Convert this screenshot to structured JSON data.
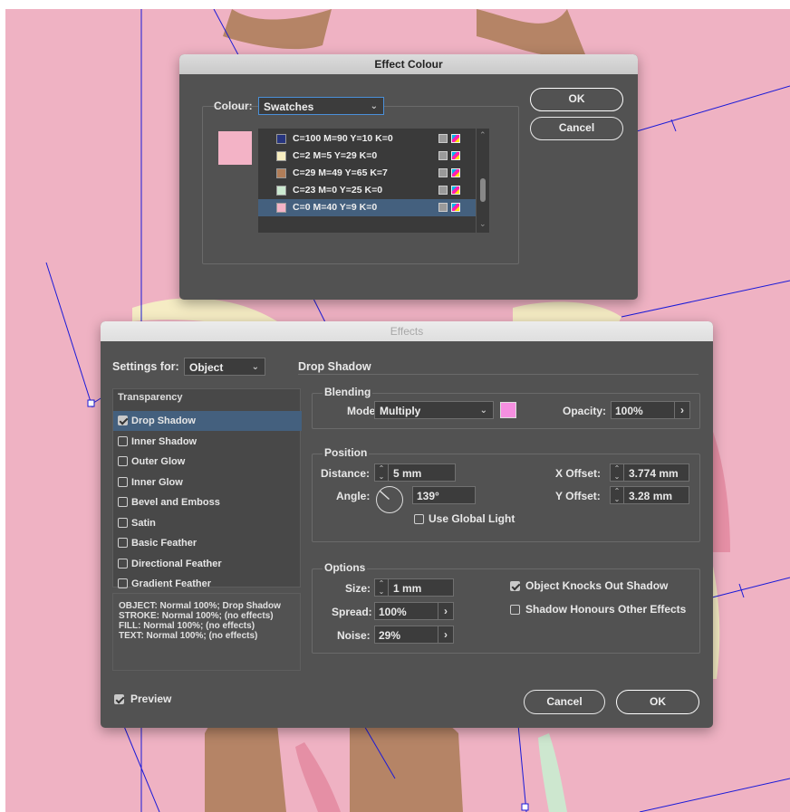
{
  "effect_colour_dialog": {
    "title": "Effect Colour",
    "colour_label": "Colour:",
    "colour_value": "Swatches",
    "ok_label": "OK",
    "cancel_label": "Cancel",
    "preview_color": "#f3b3c6",
    "swatches": [
      {
        "name": "C=100 M=90 Y=10 K=0",
        "color": "#27357f"
      },
      {
        "name": "C=2 M=5 Y=29 K=0",
        "color": "#f8eec0"
      },
      {
        "name": "C=29 M=49 Y=65 K=7",
        "color": "#b07d58"
      },
      {
        "name": "C=23 M=0 Y=25 K=0",
        "color": "#cbe9d0"
      },
      {
        "name": "C=0 M=40 Y=9 K=0",
        "color": "#f3b3c6",
        "selected": true
      }
    ]
  },
  "effects_dialog": {
    "title": "Effects",
    "settings_for_label": "Settings for:",
    "settings_for_value": "Object",
    "section_title": "Drop Shadow",
    "effects_header": "Transparency",
    "effects_list": [
      {
        "label": "Drop Shadow",
        "checked": true,
        "selected": true
      },
      {
        "label": "Inner Shadow",
        "checked": false
      },
      {
        "label": "Outer Glow",
        "checked": false
      },
      {
        "label": "Inner Glow",
        "checked": false
      },
      {
        "label": "Bevel and Emboss",
        "checked": false
      },
      {
        "label": "Satin",
        "checked": false
      },
      {
        "label": "Basic Feather",
        "checked": false
      },
      {
        "label": "Directional Feather",
        "checked": false
      },
      {
        "label": "Gradient Feather",
        "checked": false
      }
    ],
    "summary": [
      "OBJECT: Normal 100%; Drop Shadow",
      "STROKE: Normal 100%; (no effects)",
      "FILL: Normal 100%; (no effects)",
      "TEXT: Normal 100%; (no effects)"
    ],
    "blending": {
      "title": "Blending",
      "mode_label": "Mode:",
      "mode_value": "Multiply",
      "shadow_color": "#f58fe0",
      "opacity_label": "Opacity:",
      "opacity_value": "100%"
    },
    "position": {
      "title": "Position",
      "distance_label": "Distance:",
      "distance_value": "5 mm",
      "angle_label": "Angle:",
      "angle_value": "139°",
      "use_global_light_label": "Use Global Light",
      "x_offset_label": "X Offset:",
      "x_offset_value": "3.774 mm",
      "y_offset_label": "Y Offset:",
      "y_offset_value": "3.28 mm"
    },
    "options": {
      "title": "Options",
      "size_label": "Size:",
      "size_value": "1 mm",
      "spread_label": "Spread:",
      "spread_value": "100%",
      "noise_label": "Noise:",
      "noise_value": "29%",
      "knocks_out_label": "Object Knocks Out Shadow",
      "honours_label": "Shadow Honours Other Effects"
    },
    "preview_label": "Preview",
    "cancel_label": "Cancel",
    "ok_label": "OK"
  },
  "colors": {
    "canvas_bg": "#efb2c3",
    "dialog_bg": "#525252",
    "selection": "#44607e"
  }
}
